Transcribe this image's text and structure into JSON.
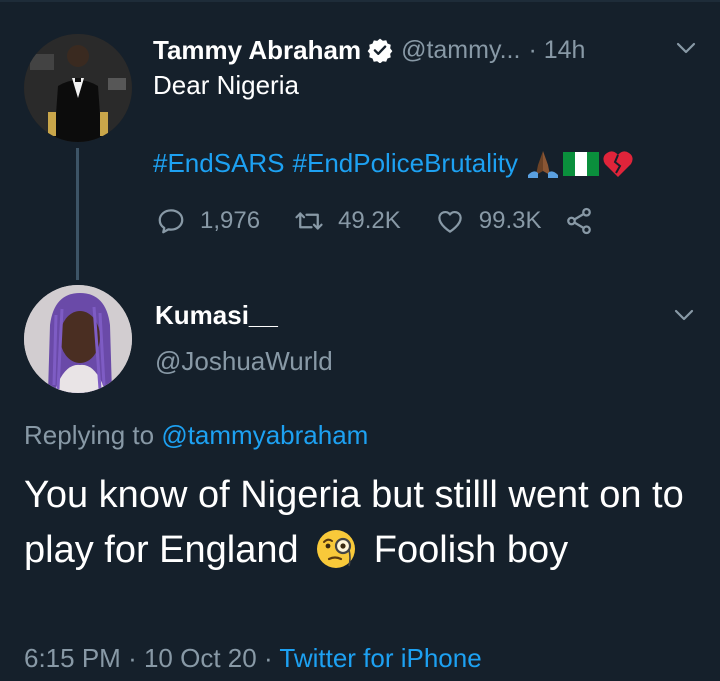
{
  "parent_tweet": {
    "author_name": "Tammy Abraham",
    "handle": "@tammy...",
    "separator": "·",
    "time": "14h",
    "text": "Dear Nigeria",
    "hashtags": [
      "#EndSARS",
      "#EndPoliceBrutality"
    ],
    "emojis": [
      "praying-hands-icon",
      "nigeria-flag-icon",
      "broken-heart-icon"
    ],
    "stats": {
      "replies": "1,976",
      "retweets": "49.2K",
      "likes": "99.3K"
    }
  },
  "reply_tweet": {
    "author_name": "Kumasi__",
    "handle": "@JoshuaWurld",
    "replying_prefix": "Replying to",
    "replying_to": "@tammyabraham",
    "text_part1": "You know of Nigeria but stilll went on to play for England",
    "text_part2": "Foolish boy",
    "time": "6:15 PM",
    "separator": "·",
    "date": "10 Oct 20",
    "separator2": "·",
    "client": "Twitter for iPhone"
  },
  "colors": {
    "background": "#15202b",
    "text": "#ffffff",
    "muted": "#8899a6",
    "accent": "#1da1f2"
  }
}
